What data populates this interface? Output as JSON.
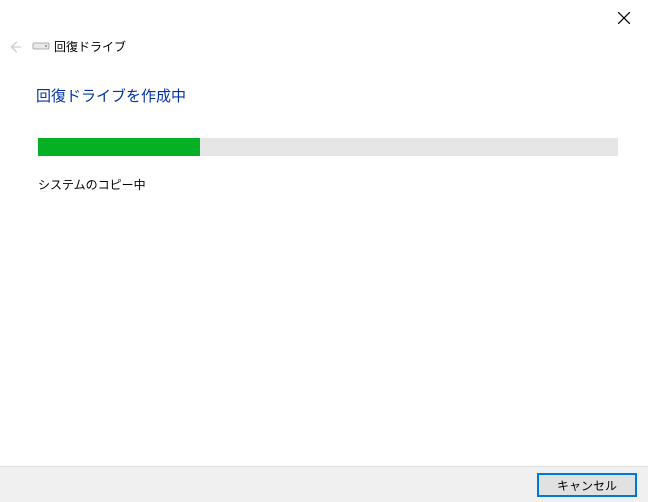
{
  "window": {
    "title": "回復ドライブ"
  },
  "main": {
    "heading": "回復ドライブを作成中",
    "status_text": "システムのコピー中",
    "progress_percent": 28
  },
  "footer": {
    "cancel_label": "キャンセル"
  },
  "colors": {
    "accent": "#0078d7",
    "heading": "#0033aa",
    "progress": "#06b025"
  }
}
